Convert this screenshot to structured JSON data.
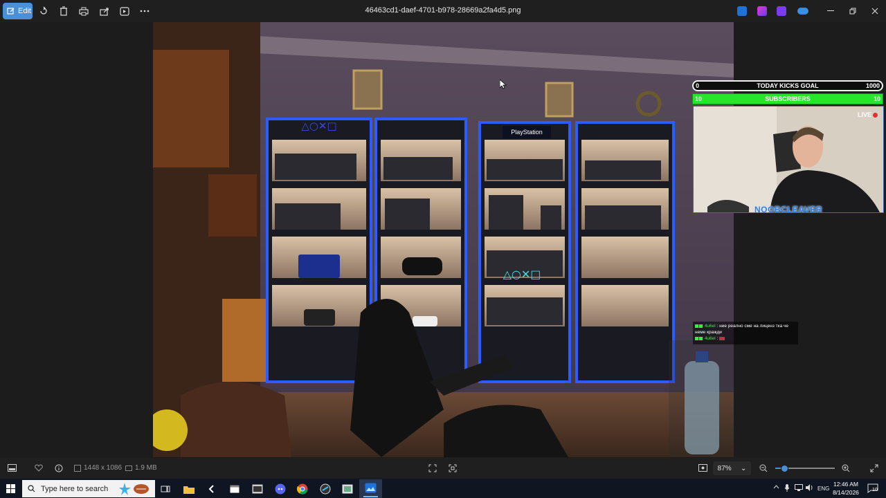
{
  "window": {
    "title": "46463cd1-daef-4701-b978-28669a2fa4d5.png",
    "edit_label": "Edit",
    "toolbar_icons": [
      "rotate-icon",
      "delete-icon",
      "print-icon",
      "share-icon",
      "slideshow-icon",
      "more-icon"
    ],
    "window_controls": [
      "minimize",
      "restore",
      "close"
    ]
  },
  "overlay": {
    "goal": {
      "min": "0",
      "label": "TODAY KICKS GOAL",
      "max": "1000",
      "progress": 0
    },
    "subs": {
      "min": "10",
      "label": "SUBSCRIBERS",
      "max": "10",
      "progress": 1.0
    },
    "live_label": "LIVE",
    "streamer_name": "NOOBCLEAVER"
  },
  "chat": {
    "messages": [
      {
        "user": "4u6el",
        "text": ": ние реално сме на лиценз тка че неме кражди"
      },
      {
        "user": "4u6el",
        "text": ":"
      }
    ]
  },
  "infobar": {
    "dimensions": "1448 x 1086",
    "filesize": "1.9 MB",
    "zoom": "87%",
    "zoom_fraction": 0.87
  },
  "taskbar": {
    "search_placeholder": "Type here to search",
    "language": "ENG",
    "time": "12:46 AM",
    "date": "8/14/2026",
    "notifications": "10"
  },
  "colors": {
    "accent": "#4a8fd8",
    "subs_green": "#27e52b",
    "live_red": "#e03030",
    "shelf_led": "#2a5cff"
  }
}
